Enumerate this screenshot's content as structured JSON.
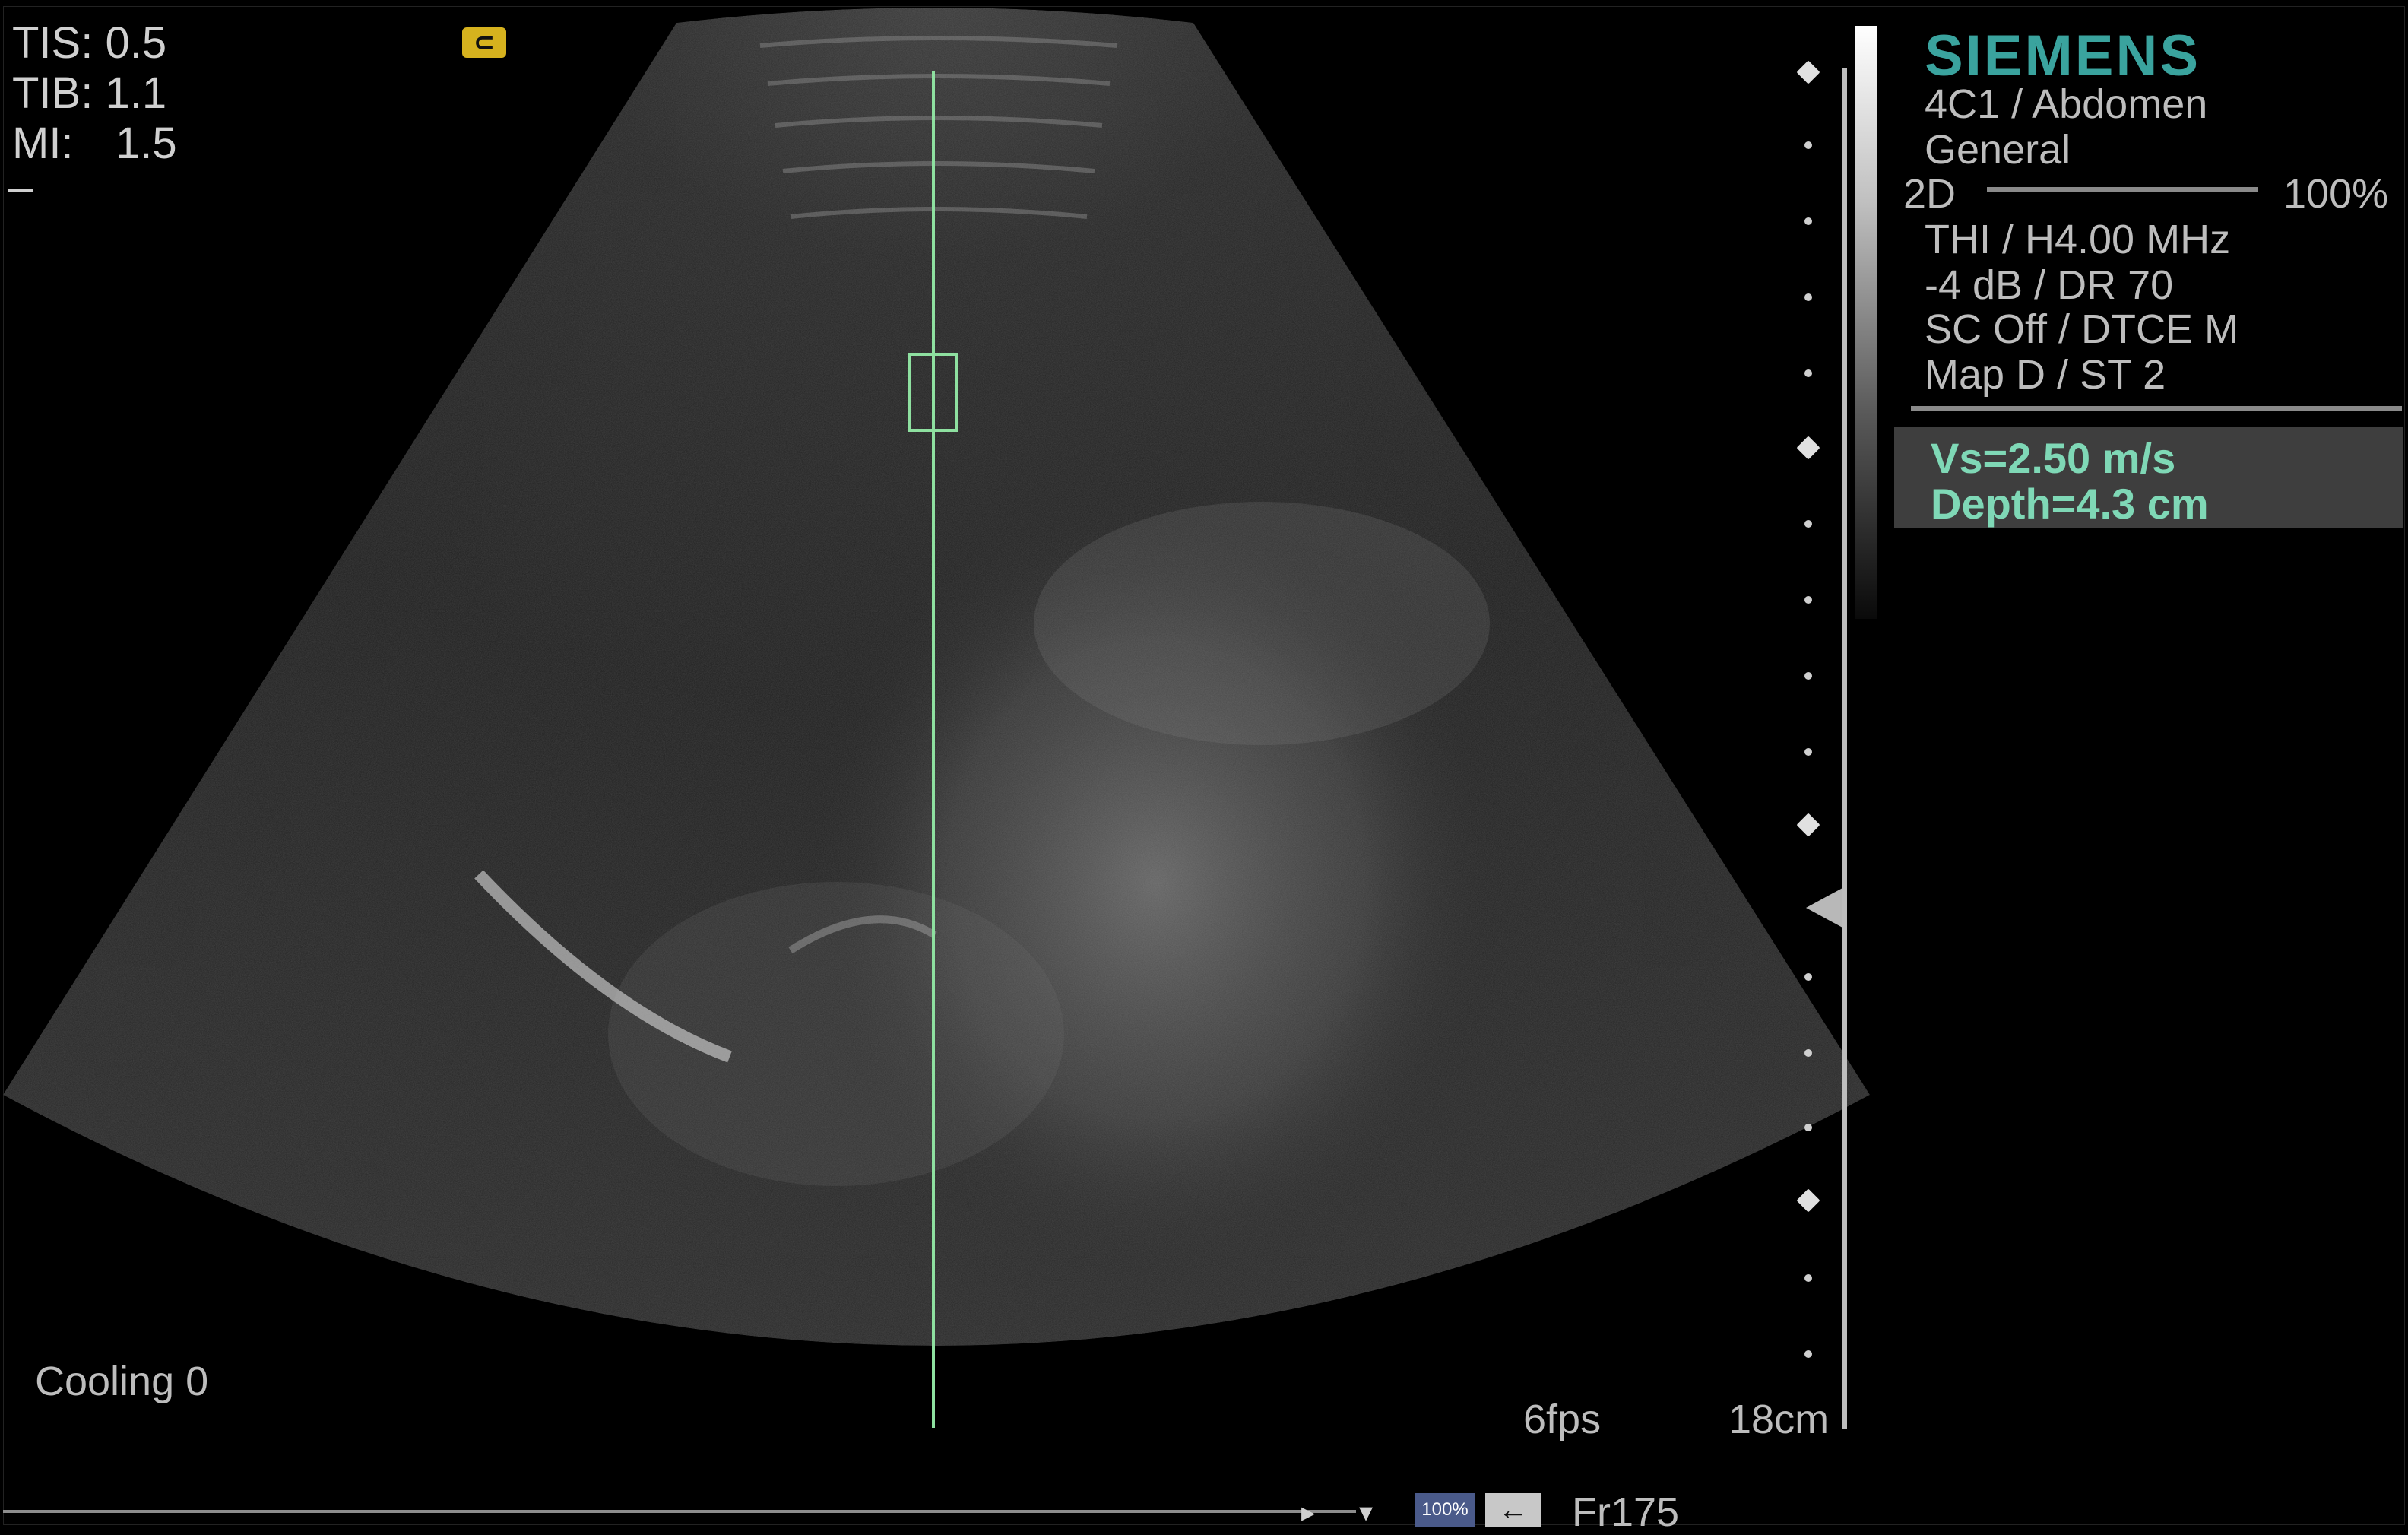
{
  "safety": {
    "tis": "TIS: 0.5",
    "tib": "TIB: 1.1",
    "mi_label": "MI:",
    "mi_value": "1.5"
  },
  "orientation_marker": {
    "glyph": "⊂",
    "icon": "probe-orientation-icon",
    "color": "#d6b21e"
  },
  "brand": {
    "name": "SIEMENS",
    "color": "#3aa39e"
  },
  "preset": {
    "probe": "4C1 / Abdomen",
    "exam": "General",
    "mode": "2D",
    "power": "100%",
    "harmonic": "THI / H4.00 MHz",
    "gain": "-4 dB / DR 70",
    "processing": "SC Off / DTCE M",
    "map": "Map D / ST 2"
  },
  "measurement": {
    "vs": "Vs=2.50 m/s",
    "depth": "Depth=4.3 cm",
    "text_color": "#7fd8b6",
    "roi_color": "#8ee0a0"
  },
  "footer": {
    "cooling": "Cooling 0",
    "fps": "6fps",
    "depth_scale": "18cm",
    "zoom": "100%",
    "back_icon": "arrow-left-icon",
    "frame": "Fr175"
  }
}
